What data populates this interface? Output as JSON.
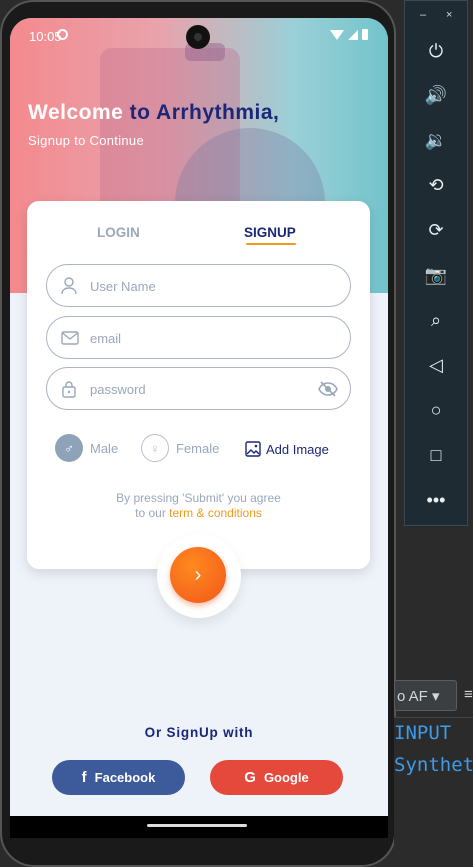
{
  "status_bar": {
    "time": "10:05"
  },
  "header": {
    "welcome_part1": "Welcome ",
    "welcome_part2": "to Arrhythmia,",
    "subtitle": "Signup to Continue"
  },
  "tabs": {
    "login": "LOGIN",
    "signup": "SIGNUP",
    "active": "signup"
  },
  "form": {
    "username_placeholder": "User Name",
    "email_placeholder": "email",
    "password_placeholder": "password"
  },
  "gender": {
    "male": "Male",
    "female": "Female",
    "selected": "male"
  },
  "add_image_label": "Add Image",
  "terms": {
    "line1": "By pressing 'Submit' you agree",
    "line2_prefix": "to our ",
    "link": "term & conditions"
  },
  "submit_glyph": "›",
  "or_signup": "Or SignUp with",
  "social": {
    "facebook": "Facebook",
    "google": "Google"
  },
  "colors": {
    "accent": "#ef9a1a",
    "brand_navy": "#1b2777",
    "facebook": "#3d5a9a",
    "google": "#e5493b",
    "submit": "#f2561b"
  },
  "emulator": {
    "close": "×",
    "minimize": "–",
    "buttons": [
      "power-icon",
      "volume-up-icon",
      "volume-down-icon",
      "rotate-left-icon",
      "rotate-right-icon",
      "camera-icon",
      "zoom-icon",
      "back-icon",
      "home-icon",
      "overview-icon",
      "more-icon"
    ]
  },
  "ide": {
    "tab_label": "o AF",
    "menu_glyph": "≡",
    "code_line1": "INPUT",
    "code_line2": "Synthet"
  }
}
